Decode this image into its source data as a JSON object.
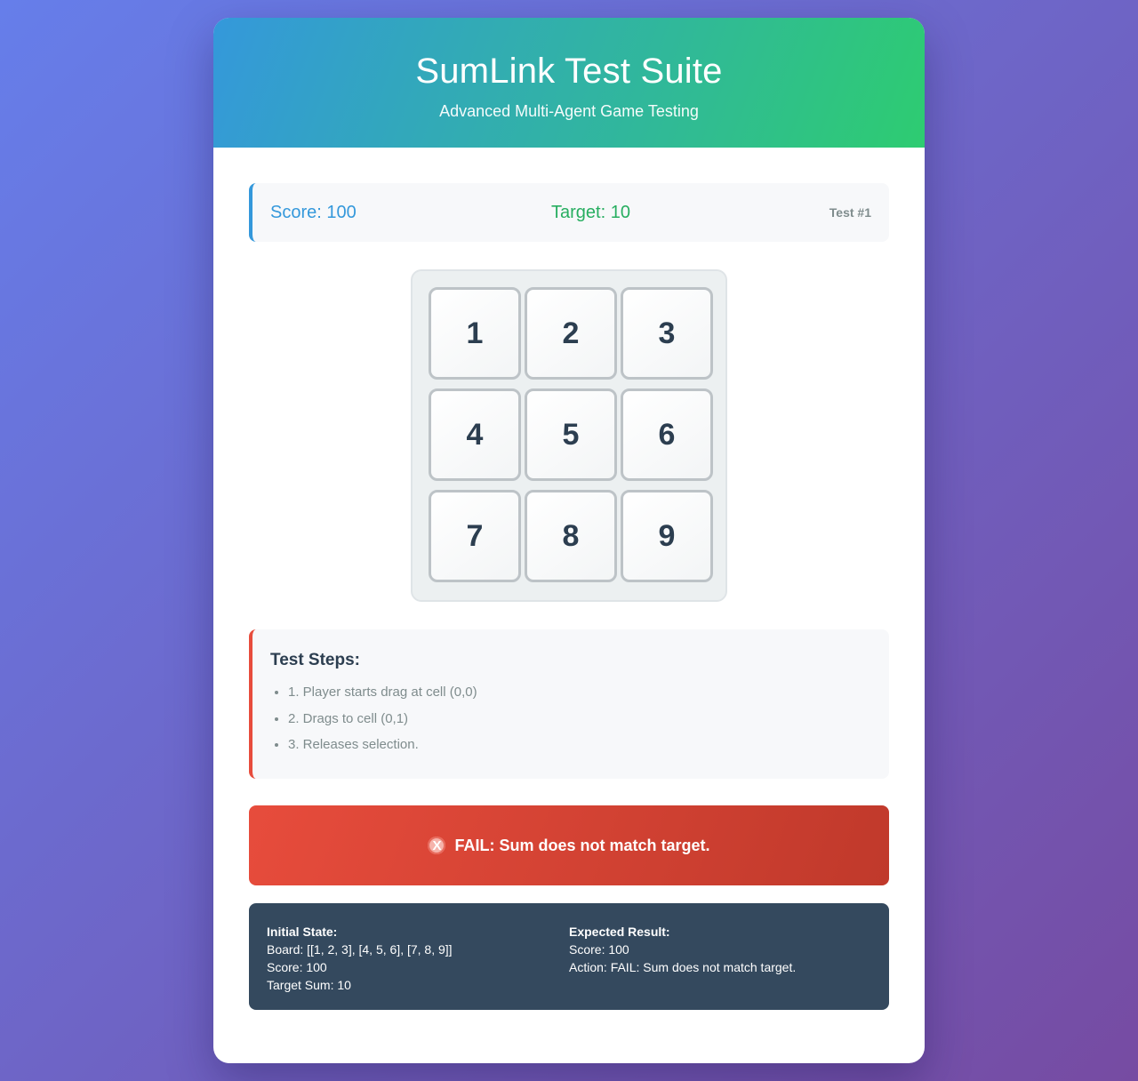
{
  "header": {
    "title": "SumLink Test Suite",
    "subtitle": "Advanced Multi-Agent Game Testing"
  },
  "status": {
    "score": "Score: 100",
    "target": "Target: 10",
    "test_number": "Test #1"
  },
  "board": {
    "cells": [
      "1",
      "2",
      "3",
      "4",
      "5",
      "6",
      "7",
      "8",
      "9"
    ]
  },
  "steps": {
    "title": "Test Steps:",
    "items": [
      "1. Player starts drag at cell (0,0)",
      "2. Drags to cell (0,1)",
      "3. Releases selection."
    ]
  },
  "result": {
    "icon": "x-icon",
    "icon_glyph": "X",
    "message": "FAIL: Sum does not match target.",
    "color": "#e74c3c"
  },
  "details": {
    "initial": {
      "title": "Initial State:",
      "board": "Board: [[1, 2, 3], [4, 5, 6], [7, 8, 9]]",
      "score": "Score: 100",
      "target": "Target Sum: 10"
    },
    "expected": {
      "title": "Expected Result:",
      "score": "Score: 100",
      "action": "Action: FAIL: Sum does not match target."
    }
  },
  "colors": {
    "accent_blue": "#3498db",
    "accent_green": "#2ecc71",
    "fail_red": "#e74c3c",
    "dark_panel": "#34495e"
  }
}
